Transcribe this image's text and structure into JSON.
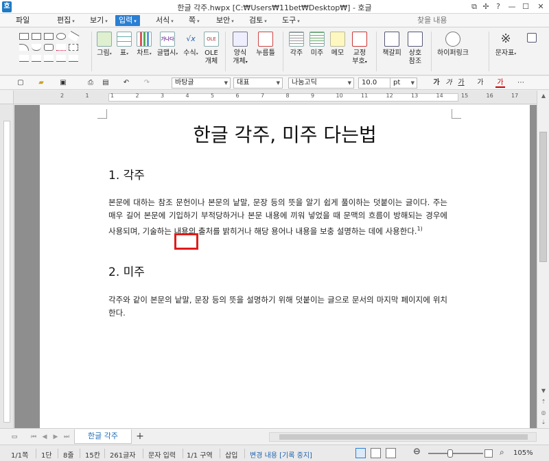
{
  "window": {
    "title": "한글 각주.hwpx [C:₩Users₩11bet₩Desktop₩] - 호글",
    "app_icon": "호",
    "controls": [
      "⧉",
      "✢",
      "?",
      "—",
      "☐",
      "✕"
    ]
  },
  "menu": {
    "items": [
      {
        "label": "파일",
        "arrow": ""
      },
      {
        "label": "편집",
        "arrow": "▾"
      },
      {
        "label": "보기",
        "arrow": "▾"
      },
      {
        "label": "입력",
        "arrow": "▾",
        "active": true
      },
      {
        "label": "서식",
        "arrow": "▾"
      },
      {
        "label": "쪽",
        "arrow": "▾"
      },
      {
        "label": "보안",
        "arrow": "▾"
      },
      {
        "label": "검토",
        "arrow": "▾"
      },
      {
        "label": "도구",
        "arrow": "▾"
      }
    ],
    "search_placeholder": "찾을 내용"
  },
  "ribbon": {
    "buttons": [
      {
        "label": "그림",
        "arrow": "▾",
        "icon": "picture-icon"
      },
      {
        "label": "표",
        "arrow": "▾",
        "icon": "table-icon"
      },
      {
        "label": "차트",
        "arrow": "▾",
        "icon": "chart-icon"
      },
      {
        "label": "글맵시",
        "arrow": "▾",
        "icon": "wordart-icon"
      },
      {
        "label": "수식",
        "arrow": "▾",
        "icon": "equation-icon"
      },
      {
        "label": "OLE",
        "label2": "개체",
        "icon": "ole-icon"
      },
      {
        "label": "양식",
        "label2": "개체",
        "arrow": "▾",
        "icon": "form-icon"
      },
      {
        "label": "누름틀",
        "icon": "field-icon"
      },
      {
        "label": "각주",
        "icon": "footnote-icon"
      },
      {
        "label": "미주",
        "icon": "endnote-icon"
      },
      {
        "label": "메모",
        "icon": "memo-icon"
      },
      {
        "label": "교정",
        "label2": "부호",
        "arrow": "▾",
        "icon": "proofmark-icon"
      },
      {
        "label": "책갈피",
        "icon": "bookmark-icon"
      },
      {
        "label": "상호",
        "label2": "참조",
        "icon": "crossref-icon"
      },
      {
        "label": "하이퍼링크",
        "icon": "hyperlink-icon"
      },
      {
        "label": "문자표",
        "arrow": "▾",
        "icon": "charmap-icon"
      }
    ],
    "icon_text": {
      "ole": "OLE",
      "wordart": "가나다",
      "equation": "√x"
    }
  },
  "toolbar2": {
    "style": "바탕글",
    "rep": "대표",
    "font": "나눔고딕",
    "size": "10.0",
    "unit": "pt",
    "format_buttons": [
      "가",
      "가",
      "가",
      "가",
      "가"
    ]
  },
  "ruler": {
    "numbers": [
      "2",
      "1",
      "1",
      "2",
      "3",
      "4",
      "5",
      "6",
      "7",
      "8",
      "9",
      "10",
      "11",
      "12",
      "13",
      "14",
      "15",
      "16",
      "17"
    ]
  },
  "document": {
    "title": "한글 각주, 미주 다는법",
    "section1_heading": "1. 각주",
    "section1_body": "본문에 대하는 참조 문헌이나 본문의 낱말, 문장 등의 뜻을 알기 쉽게 풀이하는 덧붙이는 글이다. 주는 매우 길어 본문에 기입하기 부적당하거나 본문 내용에 끼워 넣었을 때 문맥의 흐름이 방해되는 경우에 사용되며, 기술하는 내용의 출처를 밝히거나 해당 용어나 내용을 보충 설명하는 데에 사용한다.",
    "footnote_marker": "1)",
    "section2_heading": "2. 미주",
    "section2_body": "각주와 같이 본문의 낱말, 문장 등의 뜻을 설명하기 위해 덧붙이는 글으로 문서의 마지막 페이지에 위치한다."
  },
  "tabs": {
    "document_tab": "한글 각주",
    "add": "+"
  },
  "status": {
    "page": "1/1쪽",
    "column": "1단",
    "line": "8줄",
    "col": "15칸",
    "chars": "261글자",
    "mode": "문자 입력",
    "section": "1/1 구역",
    "insert": "삽입",
    "track": "변경 내용 [기록 중지]",
    "zoom": "105%"
  }
}
